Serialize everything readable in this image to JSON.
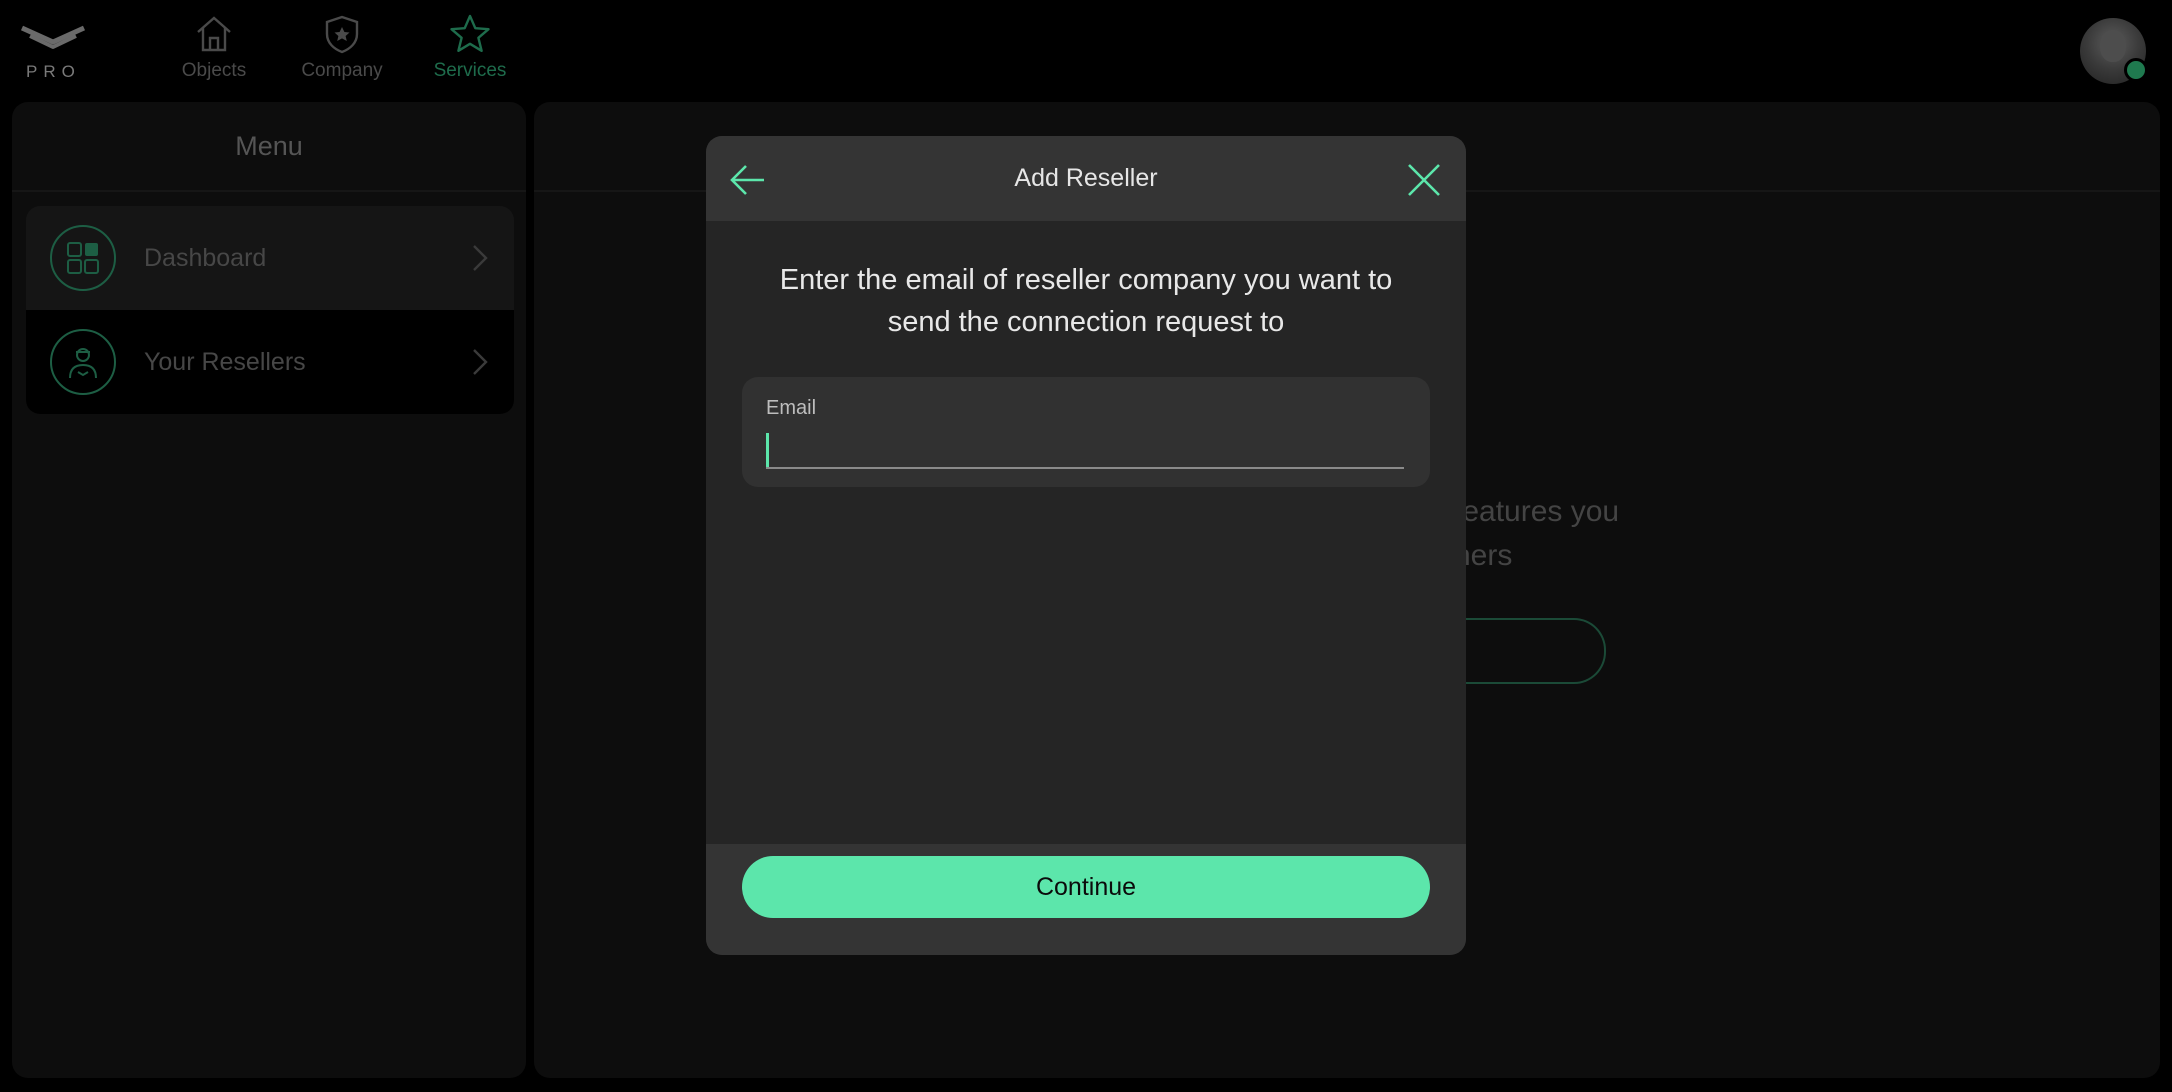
{
  "header": {
    "logo_text": "PRO",
    "nav": [
      {
        "label": "Objects",
        "icon": "home-icon"
      },
      {
        "label": "Company",
        "icon": "shield-star-icon"
      },
      {
        "label": "Services",
        "icon": "star-icon",
        "active": true
      }
    ],
    "status_color": "#1f7a4f"
  },
  "sidebar": {
    "title": "Menu",
    "items": [
      {
        "label": "Dashboard",
        "icon": "dashboard-grid-icon"
      },
      {
        "label": "Your Resellers",
        "icon": "reseller-person-icon",
        "selected": true
      }
    ]
  },
  "main": {
    "partial_text_line1": "features you",
    "partial_text_line2": "ners"
  },
  "modal": {
    "title": "Add Reseller",
    "prompt": "Enter the email of reseller company you want to send the connection request to",
    "email_label": "Email",
    "email_value": "",
    "continue_label": "Continue",
    "accent_color": "#5ce6ab"
  }
}
